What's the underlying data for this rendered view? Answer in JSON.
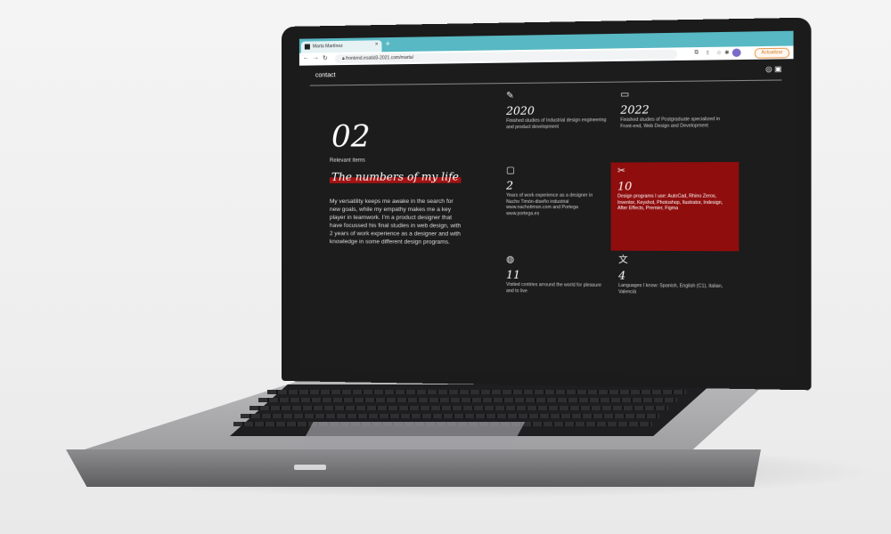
{
  "browser": {
    "tab_title": "Marta Martínez",
    "url": "frontend.esatid3-2021.com/marta/",
    "update_label": "Actualizar",
    "new_tab": "+",
    "tab_close": "×"
  },
  "site": {
    "nav_link": "contact",
    "social": [
      "instagram-icon",
      "linkedin-icon"
    ],
    "section_number": "02",
    "section_label": "Relevant items",
    "headline": "The numbers of my life",
    "intro": "My versatility keeps me awake in the search for new goals, while my empathy makes me a key player in teamwork. I'm a product designer that have focussed his final studies in web design, with 2 years of work experience as a designer and with knowledge in some different design programs.",
    "items": [
      {
        "icon": "pencil-icon",
        "number": "2020",
        "text": "Finished studies of Industrial design engineering and product development"
      },
      {
        "icon": "laptop-icon",
        "number": "2022",
        "text": "Finished studies of Postgraduate specialized in Front-end, Web Design and Development"
      },
      {
        "icon": "briefcase-icon",
        "number": "2",
        "text": "Years of work experience as a designer in Nacho Timón-diseño industrial www.nachotimon.com and Portega www.portega.es"
      },
      {
        "icon": "design-tools-icon",
        "number": "10",
        "text": "Design programs I use: AutoCad, Rhino Zeros, Inventor, Keyshot, Photoshop, Ilustrator, Indesign, After Effects, Premier, Figma"
      },
      {
        "icon": "globe-icon",
        "number": "11",
        "text": "Visited contries arround the world for pleasure and to live"
      },
      {
        "icon": "translate-icon",
        "number": "4",
        "text": "Languages I know: Spanish, English (C1), Italian, Valencià"
      }
    ]
  },
  "colors": {
    "accent_red": "#8f0d0d",
    "tab_bar": "#58b8c3",
    "site_bg": "#1c1c1c"
  }
}
